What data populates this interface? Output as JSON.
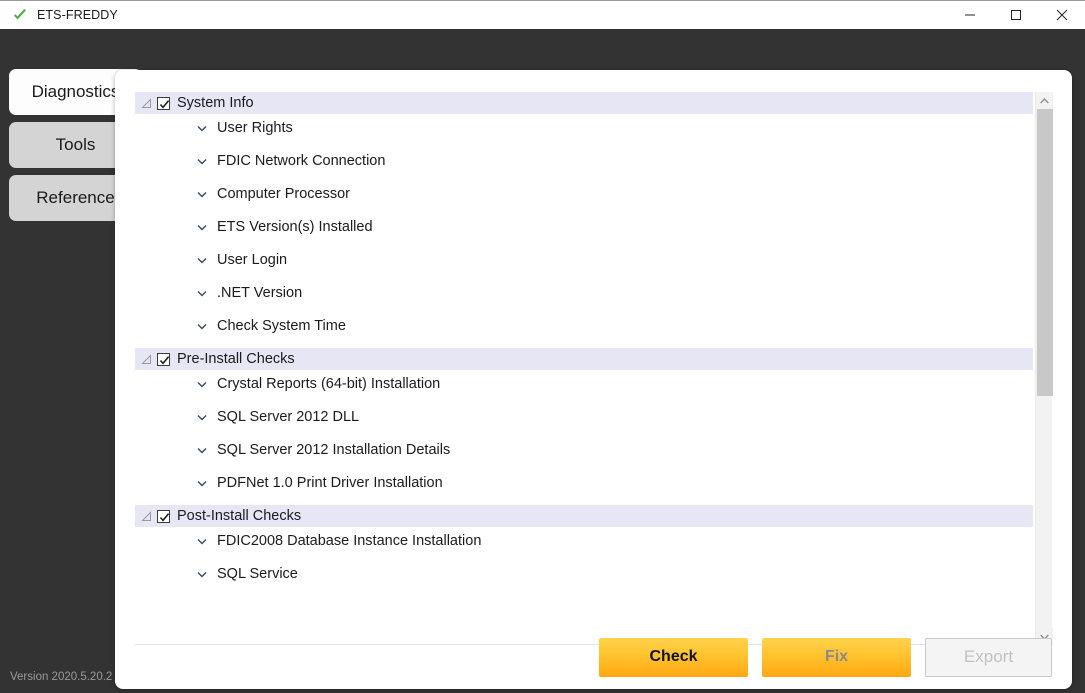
{
  "window": {
    "title": "ETS-FREDDY",
    "status_icon": "green-check-icon",
    "controls": {
      "minimize": "minimize-icon",
      "maximize": "maximize-icon",
      "close": "close-icon"
    }
  },
  "sidebar": {
    "tabs": [
      {
        "label": "Diagnostics",
        "active": true
      },
      {
        "label": "Tools",
        "active": false
      },
      {
        "label": "Reference",
        "active": false
      }
    ]
  },
  "footer_status": {
    "version": "Version 2020.5.20.2"
  },
  "tree": {
    "groups": [
      {
        "label": "System Info",
        "checked": true,
        "expanded": true,
        "children": [
          {
            "label": "User Rights"
          },
          {
            "label": "FDIC Network Connection"
          },
          {
            "label": "Computer Processor"
          },
          {
            "label": "ETS Version(s) Installed"
          },
          {
            "label": "User Login"
          },
          {
            "label": ".NET Version"
          },
          {
            "label": "Check System Time"
          }
        ]
      },
      {
        "label": "Pre-Install Checks",
        "checked": true,
        "expanded": true,
        "children": [
          {
            "label": "Crystal Reports (64-bit) Installation"
          },
          {
            "label": "SQL Server 2012 DLL"
          },
          {
            "label": "SQL Server 2012 Installation Details"
          },
          {
            "label": "PDFNet 1.0 Print Driver Installation"
          }
        ]
      },
      {
        "label": "Post-Install Checks",
        "checked": true,
        "expanded": true,
        "children": [
          {
            "label": "FDIC2008 Database Instance Installation"
          },
          {
            "label": "SQL Service"
          }
        ]
      }
    ]
  },
  "scrollbar": {
    "up_icon": "chevron-up-icon",
    "down_icon": "chevron-down-icon",
    "thumb_position_percent": 0,
    "thumb_size_percent": 54
  },
  "actions": {
    "check": {
      "label": "Check",
      "enabled": true
    },
    "fix": {
      "label": "Fix",
      "enabled": false
    },
    "export": {
      "label": "Export",
      "enabled": false
    }
  },
  "colors": {
    "accent_orange": "#ffc22e",
    "group_row_bg": "#e6e6f5",
    "app_bg": "#333333",
    "status_green": "#4caf3f"
  }
}
